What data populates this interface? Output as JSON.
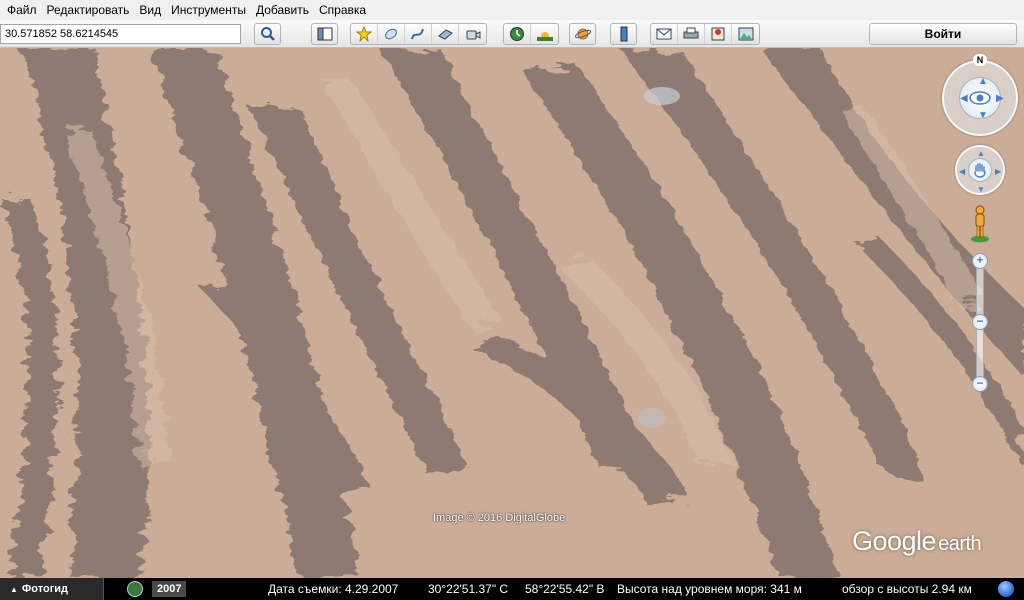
{
  "menu": {
    "items": [
      "Файл",
      "Редактировать",
      "Вид",
      "Инструменты",
      "Добавить",
      "Справка"
    ]
  },
  "toolbar": {
    "search_value": "30.571852 58.6214545",
    "login_label": "Войти",
    "icons": {
      "search": "magnifier-icon",
      "sidebar": "sidebar-toggle-icon",
      "placemark": "add-placemark-icon",
      "polygon": "add-polygon-icon",
      "path": "add-path-icon",
      "overlay": "image-overlay-icon",
      "tour": "record-tour-icon",
      "historical": "historical-imagery-icon",
      "sunlight": "sunlight-icon",
      "planets": "planet-icon",
      "ruler": "ruler-icon",
      "email": "email-icon",
      "print": "print-icon",
      "maps": "google-maps-icon",
      "save_image": "save-image-icon"
    }
  },
  "map": {
    "imagery_credit": "Image © 2016 DigitalGlobe",
    "logo_main": "Google",
    "logo_sub": "earth",
    "north_label": "N"
  },
  "statusbar": {
    "tour_guide_label": "Фотогид",
    "historical_year": "2007",
    "imagery_date": "Дата съемки: 4.29.2007",
    "latitude": "30°22'51.37\" С",
    "longitude": "58°22'55.42\" В",
    "elevation": "Высота над уровнем моря:   341 м",
    "eye_alt": "обзор с высоты   2.94 км"
  },
  "colors": {
    "sand_light": "#e0c0a8",
    "sand_dark": "#7a6560",
    "nav_blue": "#4a7fbf"
  }
}
